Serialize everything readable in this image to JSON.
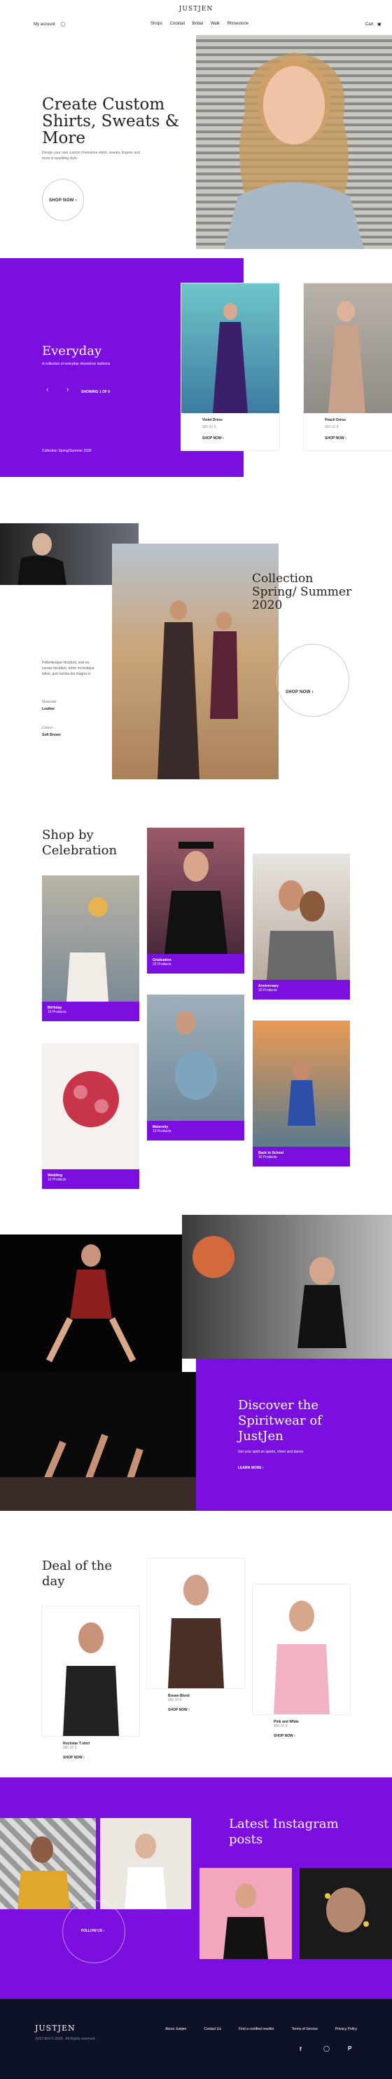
{
  "header": {
    "brand": "JUSTJEN",
    "account": "My account",
    "nav": [
      "Shops",
      "Cocktail",
      "Bridal",
      "Walk",
      "Rhinestone"
    ],
    "cart": "Cart"
  },
  "hero": {
    "title": "Create Custom Shirts, Sweats & More",
    "subtitle": "Design your own custom rhinestone shirts, sweats, lingerie and more in sparkling style.",
    "cta": "SHOP NOW"
  },
  "everyday": {
    "title": "Everyday",
    "subtitle": "A collection of everyday rhinestone fashions",
    "pager": "SHOWING 1 OF 6",
    "footnote": "Collection Spring/Summer 2020",
    "products": [
      {
        "name": "Violet Dress",
        "price": "$80,00 $",
        "cta": "SHOP NOW"
      },
      {
        "name": "Peach Dress",
        "price": "$80,00 $",
        "cta": "SHOP NOW"
      }
    ]
  },
  "collection": {
    "title": "Collection Spring/ Summer 2020",
    "description": "Pellentesque tincidunt, erat eu cursus tincidunt, tortor mi tristique tellus, quis lacinia dui magna in.",
    "material_label": "Materials:",
    "material_value": "Leather",
    "color_label": "Colors:",
    "color_value": "Soft Brown",
    "cta": "SHOP NOW"
  },
  "celebration": {
    "title": "Shop by Celebration",
    "items": [
      {
        "name": "Birthday",
        "count": "16 Products"
      },
      {
        "name": "Graduation",
        "count": "22 Products"
      },
      {
        "name": "Anniversary",
        "count": "18 Products"
      },
      {
        "name": "Maternity",
        "count": "15 Products"
      },
      {
        "name": "Wedding",
        "count": "12 Products"
      },
      {
        "name": "Back to School",
        "count": "16 Products"
      }
    ]
  },
  "spiritwear": {
    "title": "Discover the Spiritwear of JustJen",
    "subtitle": "Get your spirit on sports, cheer and dance.",
    "cta": "LEARN MORE"
  },
  "deal": {
    "title": "Deal of the day",
    "products": [
      {
        "name": "Rockstar T-shirt",
        "price": "$80,00 $",
        "cta": "SHOP NOW"
      },
      {
        "name": "Brown Blend",
        "price": "$80,00 $",
        "cta": "SHOP NOW"
      },
      {
        "name": "Pink and White",
        "price": "$80,00 $",
        "cta": "SHOP NOW"
      }
    ]
  },
  "instagram": {
    "title": "Latest Instagram posts",
    "cta": "FOLLOW US"
  },
  "footer": {
    "brand": "JUSTJEN",
    "copyright": "JUSTJEN © 2020 . All Rights reserved.",
    "links": [
      "About Justjen",
      "Contact Us",
      "Find a certified reseller",
      "Terms of Service",
      "Privacy Policy"
    ],
    "social": [
      "facebook-icon",
      "instagram-icon",
      "pinterest-icon"
    ]
  },
  "colors": {
    "accent": "#7a0fe0",
    "footer_bg": "#0d1226"
  }
}
